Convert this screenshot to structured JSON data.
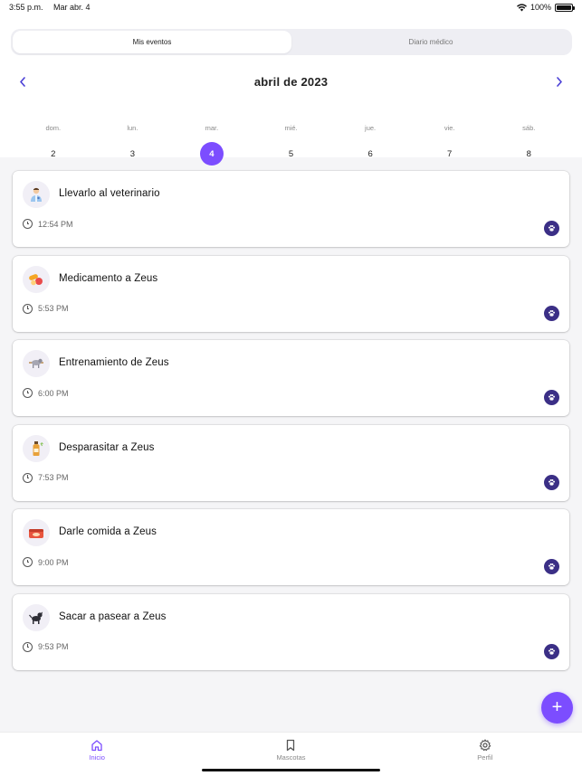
{
  "status_bar": {
    "time": "3:55 p.m.",
    "date": "Mar abr. 4",
    "battery": "100%"
  },
  "segmented": {
    "tabs": [
      {
        "label": "Mis eventos",
        "active": true
      },
      {
        "label": "Diario médico",
        "active": false
      }
    ]
  },
  "calendar": {
    "month": "abril de 2023",
    "prev_icon": "chevron-left-icon",
    "next_icon": "chevron-right-icon",
    "days": [
      {
        "name": "dom.",
        "num": "2"
      },
      {
        "name": "lun.",
        "num": "3"
      },
      {
        "name": "mar.",
        "num": "4",
        "active": true
      },
      {
        "name": "mié.",
        "num": "5"
      },
      {
        "name": "jue.",
        "num": "6"
      },
      {
        "name": "vie.",
        "num": "7"
      },
      {
        "name": "sáb.",
        "num": "8"
      }
    ]
  },
  "events": [
    {
      "title": "Llevarlo al veterinario",
      "time": "12:54 PM",
      "icon": "veterinarian-icon"
    },
    {
      "title": "Medicamento a Zeus",
      "time": "5:53 PM",
      "icon": "pills-icon"
    },
    {
      "title": "Entrenamiento de Zeus",
      "time": "6:00 PM",
      "icon": "training-dog-icon"
    },
    {
      "title": "Desparasitar a Zeus",
      "time": "7:53 PM",
      "icon": "deworming-bottle-icon"
    },
    {
      "title": "Darle comida a Zeus",
      "time": "9:00 PM",
      "icon": "food-box-icon"
    },
    {
      "title": "Sacar a pasear a Zeus",
      "time": "9:53 PM",
      "icon": "walking-dog-icon"
    }
  ],
  "fab": {
    "icon": "plus-icon",
    "label": "+"
  },
  "bottom_nav": {
    "tabs": [
      {
        "label": "Inicio",
        "icon": "home-icon",
        "active": true
      },
      {
        "label": "Mascotas",
        "icon": "bookmark-icon",
        "active": false
      },
      {
        "label": "Perfil",
        "icon": "gear-icon",
        "active": false
      }
    ]
  },
  "colors": {
    "accent": "#7c4dff",
    "badge": "#3b2f86",
    "nav_arrow": "#4a3fd6"
  }
}
